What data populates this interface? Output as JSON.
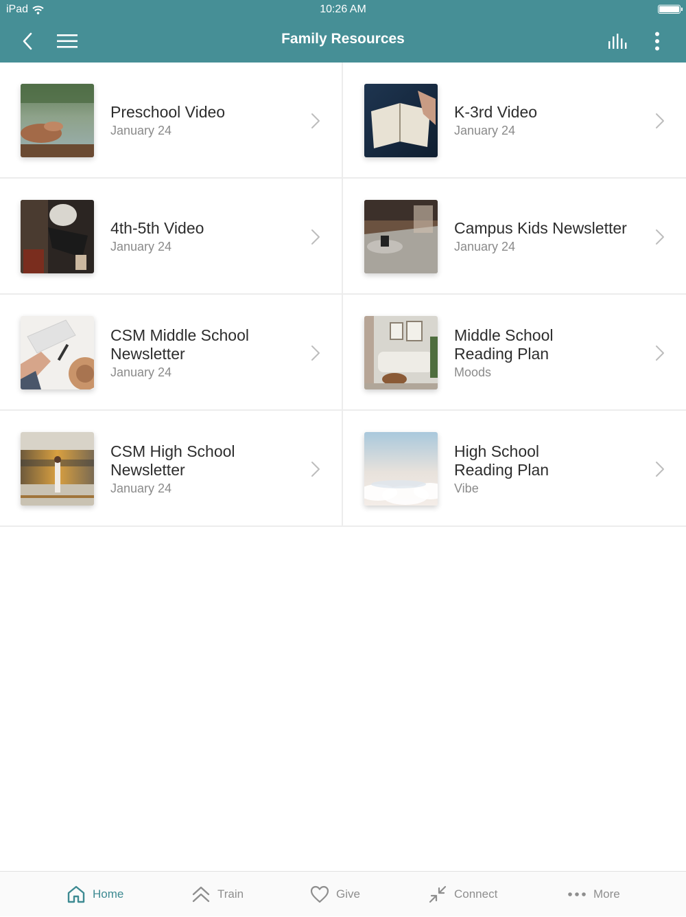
{
  "status_bar": {
    "carrier": "iPad",
    "time": "10:26 AM"
  },
  "header": {
    "title": "Family Resources"
  },
  "items": [
    {
      "title": "Preschool Video",
      "subtitle": "January 24",
      "thumb_icon": "lake-hands-photo"
    },
    {
      "title": "K-3rd Video",
      "subtitle": "January 24",
      "thumb_icon": "open-bible-photo"
    },
    {
      "title": "4th-5th Video",
      "subtitle": "January 24",
      "thumb_icon": "seated-person-photo"
    },
    {
      "title": "Campus Kids Newsletter",
      "subtitle": "January 24",
      "thumb_icon": "living-room-rug-photo"
    },
    {
      "title": "CSM Middle School Newsletter",
      "subtitle": "January 24",
      "thumb_icon": "desk-keyboard-hat-photo"
    },
    {
      "title": "Middle School Reading Plan",
      "subtitle": "Moods",
      "thumb_icon": "sofa-room-photo"
    },
    {
      "title": "CSM High School Newsletter",
      "subtitle": "January 24",
      "thumb_icon": "train-station-photo"
    },
    {
      "title": "High School Reading Plan",
      "subtitle": "Vibe",
      "thumb_icon": "clouds-sky-photo"
    }
  ],
  "tabs": [
    {
      "label": "Home",
      "icon": "home-icon",
      "active": true
    },
    {
      "label": "Train",
      "icon": "double-chevron-up-icon",
      "active": false
    },
    {
      "label": "Give",
      "icon": "heart-icon",
      "active": false
    },
    {
      "label": "Connect",
      "icon": "collapse-arrows-icon",
      "active": false
    },
    {
      "label": "More",
      "icon": "ellipsis-icon",
      "active": false
    }
  ],
  "colors": {
    "header_bg": "#468f96",
    "accent": "#3d8a92",
    "inactive_tab": "#8e8e8e"
  }
}
